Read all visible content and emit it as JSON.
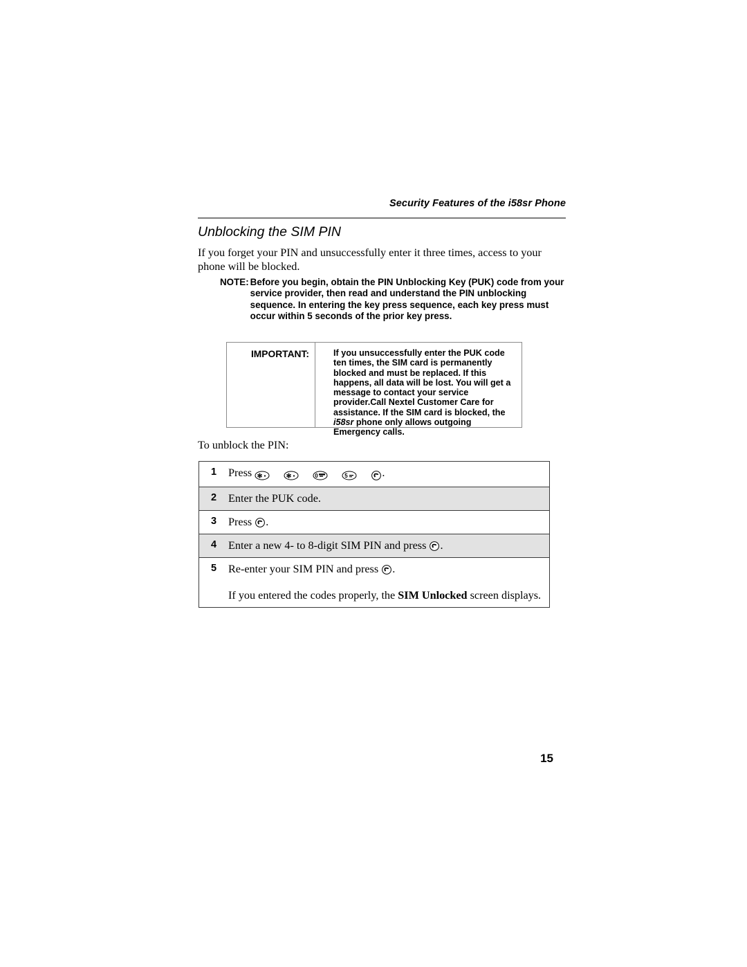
{
  "header": {
    "running_title": "Security Features of the i58sr Phone"
  },
  "section": {
    "heading": "Unblocking the SIM PIN",
    "intro_paragraph": "If you forget your PIN and unsuccessfully enter it three times, access to your phone will be blocked."
  },
  "note": {
    "label": "NOTE:",
    "text": "Before you begin, obtain the PIN Unblocking Key (PUK) code from your service provider, then read and understand the PIN unblocking sequence. In entering the key press sequence, each key press must occur within 5 seconds of the prior key press."
  },
  "important": {
    "label": "IMPORTANT:",
    "text_part1": "If you unsuccessfully enter the PUK code ten times, the SIM card is permanently blocked and must be replaced. If this happens, all data will be lost. You will get a message to contact your service provider.Call Nextel Customer Care for assistance. If the SIM card is blocked, the ",
    "model": "i58sr",
    "text_part2": " phone only allows outgoing Emergency calls."
  },
  "procedure": {
    "lead_in": "To unblock the PIN:",
    "steps": [
      {
        "number": "1",
        "text_before": "Press",
        "keys": [
          "star-key",
          "star-key",
          "zero-key",
          "five-key",
          "send-key"
        ],
        "text_after": ".",
        "shaded": false
      },
      {
        "number": "2",
        "text_before": "Enter the PUK code.",
        "keys": [],
        "text_after": "",
        "shaded": true
      },
      {
        "number": "3",
        "text_before": "Press",
        "keys": [
          "send-key"
        ],
        "text_after": ".",
        "shaded": false
      },
      {
        "number": "4",
        "text_before": "Enter a new 4- to 8-digit SIM PIN and press",
        "keys": [
          "send-key"
        ],
        "text_after": ".",
        "shaded": true
      },
      {
        "number": "5",
        "text_before": "Re-enter your SIM PIN and press",
        "keys": [
          "send-key"
        ],
        "text_after": ".",
        "shaded": false,
        "sub_note_before": "If you entered the codes properly, the ",
        "sub_note_bold": "SIM Unlocked",
        "sub_note_after": " screen displays."
      }
    ]
  },
  "footer": {
    "page_number": "15"
  },
  "colors": {
    "text": "#000000",
    "rule": "#7d7d7d",
    "box_border": "#8a8a8a",
    "table_border": "#3a3a3a",
    "row_shade": "#e2e2e2",
    "page_background": "#ffffff"
  }
}
